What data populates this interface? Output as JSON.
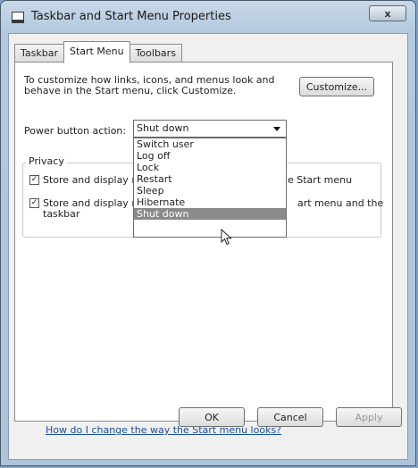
{
  "window": {
    "title": "Taskbar and Start Menu Properties",
    "close_label": "x"
  },
  "tabs": [
    {
      "label": "Taskbar"
    },
    {
      "label": "Start Menu"
    },
    {
      "label": "Toolbars"
    }
  ],
  "start_menu": {
    "description": "To customize how links, icons, and menus look and behave in the Start menu, click Customize.",
    "customize_label": "Customize...",
    "power_label": "Power button action:",
    "power_value": "Shut down",
    "power_options": [
      "Switch user",
      "Log off",
      "Lock",
      "Restart",
      "Sleep",
      "Hibernate",
      "Shut down"
    ],
    "privacy_title": "Privacy",
    "privacy_items": [
      {
        "prefix": "Store and display r",
        "suffix": "e Start menu",
        "checked": true
      },
      {
        "prefix": "Store and display r",
        "suffix": "art menu and the",
        "line2": "taskbar",
        "checked": true
      }
    ],
    "help_link": "How do I change the way the Start menu looks?"
  },
  "buttons": {
    "ok": "OK",
    "cancel": "Cancel",
    "apply": "Apply"
  },
  "icons": {
    "window": "taskbar-properties-icon",
    "dropdown": "chevron-down-icon",
    "cursor": "mouse-pointer-icon",
    "check": "check-icon"
  }
}
